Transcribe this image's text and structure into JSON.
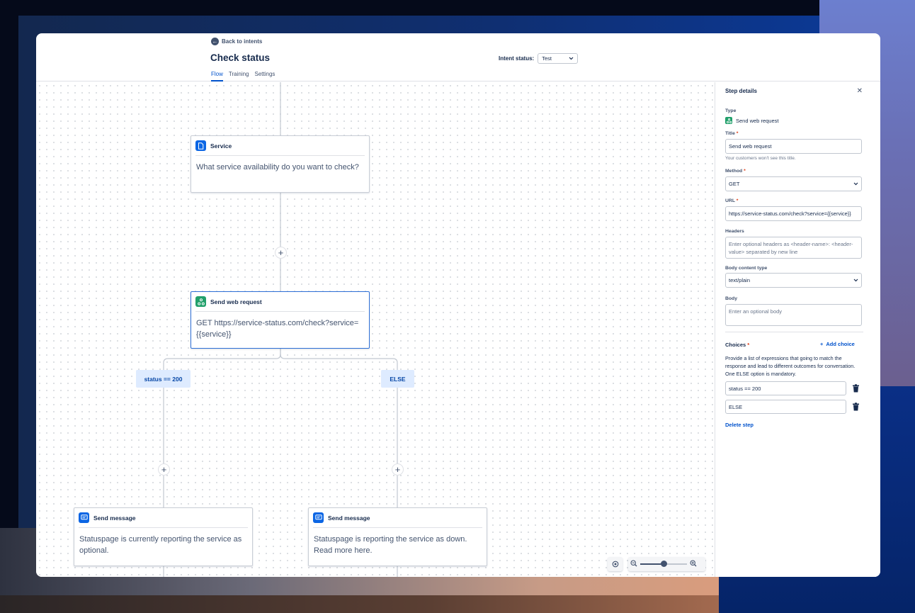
{
  "header": {
    "back_label": "Back to intents",
    "title": "Check status",
    "status_label": "Intent status:",
    "status_value": "Test",
    "tabs": [
      {
        "label": "Flow",
        "active": true
      },
      {
        "label": "Training",
        "active": false
      },
      {
        "label": "Settings",
        "active": false
      }
    ]
  },
  "flow": {
    "nodes": [
      {
        "title": "Service",
        "icon": "document-icon",
        "body": "What service availability do you want to check?"
      },
      {
        "title": "Send web request",
        "icon": "webhook-icon",
        "body": "GET https://service-status.com/check?service={{service}}",
        "selected": true
      },
      {
        "title": "Send message",
        "icon": "message-icon",
        "body": "Statuspage is currently reporting the service as optional."
      },
      {
        "title": "Send message",
        "icon": "message-icon",
        "body": "Statuspage is reporting the service as down. Read more here."
      }
    ],
    "conditions": [
      "status == 200",
      "ELSE"
    ],
    "add_step_icon": "plus-icon",
    "zoom_level": 0.5
  },
  "panel": {
    "title": "Step details",
    "close_icon": "close-icon",
    "type_label": "Type",
    "type_value": "Send web request",
    "title_label": "Title",
    "title_value": "Send web request",
    "title_helper": "Your customers won't see this title.",
    "method_label": "Method",
    "method_value": "GET",
    "url_label": "URL",
    "url_value": "https://service-status.com/check?service={{service}}",
    "headers_label": "Headers",
    "headers_placeholder": "Enter optional headers as <header-name>: <header-value> separated by new line",
    "body_type_label": "Body content type",
    "body_type_value": "text/plain",
    "body_label": "Body",
    "body_placeholder": "Enter an optional body",
    "choices_label": "Choices",
    "add_choice_label": "Add choice",
    "choices_desc": "Provide a list of expressions that going to match the response and lead to different outcomes for conversation. One ELSE option is mandatory.",
    "choices": [
      "status == 200",
      "ELSE"
    ],
    "delete_label": "Delete step",
    "required_mark": "*"
  },
  "colors": {
    "accent": "#0052CC",
    "selected_border": "#2D6FD6",
    "condition_bg": "#DEEBFF",
    "webhook_icon": "#22A06B",
    "message_icon": "#0C66E4"
  }
}
